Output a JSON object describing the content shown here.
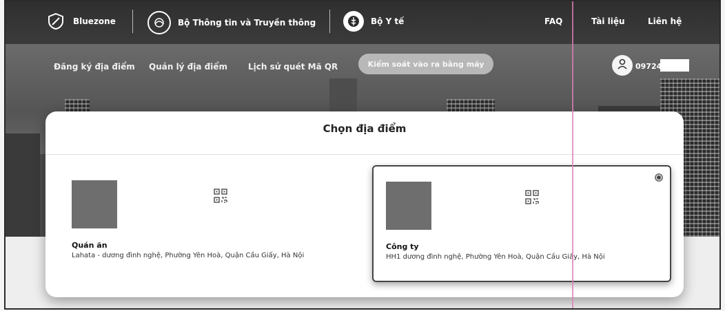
{
  "header": {
    "brand_bluezone": "Bluezone",
    "brand_ministry_info": "Bộ Thông tin và Truyền thông",
    "brand_ministry_health": "Bộ Y tế",
    "links": [
      "FAQ",
      "Tài liệu",
      "Liên hệ"
    ]
  },
  "nav": {
    "items": [
      "Đăng ký địa điểm",
      "Quản lý địa điểm",
      "Lịch sử quét Mã QR"
    ],
    "pill": "Kiểm soát vào ra bằng máy",
    "user_phone": "097247"
  },
  "modal": {
    "title": "Chọn địa điểm",
    "locations": [
      {
        "name": "Quán ăn",
        "address": "Lahata - dương đình nghệ, Phường Yên Hoà, Quận Cầu Giấy, Hà Nội",
        "selected": false
      },
      {
        "name": "Công ty",
        "address": "HH1 dương đình nghệ, Phường Yên Hoà, Quận Cầu Giấy, Hà Nội",
        "selected": true
      }
    ]
  },
  "colors": {
    "topbar": "#333333",
    "modal_bg": "#ffffff",
    "thumb": "#6e6e6e",
    "scan_line": "#d97fb8"
  },
  "icons": {
    "bluezone": "shield-icon",
    "ministry_info": "emblem-icon",
    "ministry_health": "caduceus-icon",
    "user": "user-icon",
    "qr": "qr-code-icon",
    "radio": "radio-selected-icon"
  }
}
